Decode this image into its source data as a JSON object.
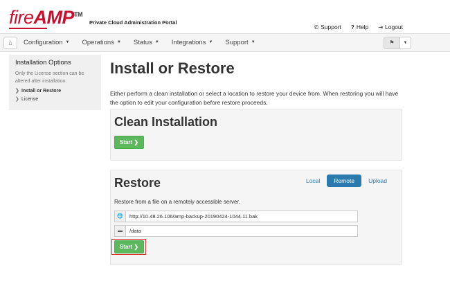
{
  "header": {
    "logo_prefix": "fire",
    "logo_main": "AMP",
    "logo_tm": "TM",
    "portal_title": "Private Cloud Administration Portal",
    "links": [
      {
        "icon": "phone-icon",
        "glyph": "✆",
        "label": "Support"
      },
      {
        "icon": "question-icon",
        "glyph": "?",
        "label": "Help"
      },
      {
        "icon": "logout-icon",
        "glyph": "⇥",
        "label": "Logout"
      }
    ]
  },
  "navbar": {
    "home_icon": "home-icon",
    "items": [
      "Configuration",
      "Operations",
      "Status",
      "Integrations",
      "Support"
    ],
    "flag_icon": "flag-icon"
  },
  "sidebar": {
    "title": "Installation Options",
    "note": "Only the License section can be altered after installation.",
    "items": [
      {
        "label": "Install or Restore",
        "active": true
      },
      {
        "label": "License",
        "active": false
      }
    ]
  },
  "main": {
    "title": "Install or Restore",
    "intro": "Either perform a clean installation or select a location to restore your device from. When restoring you will have the option to edit your configuration before restore proceeds."
  },
  "clean": {
    "title": "Clean Installation",
    "start_label": "Start ❯"
  },
  "restore": {
    "title": "Restore",
    "tabs": [
      "Local",
      "Remote",
      "Upload"
    ],
    "active_tab": "Remote",
    "description": "Restore from a file on a remotely accessible server.",
    "url_value": "http://10.48.26.106/amp-backup-20190424-1044.11.bak",
    "path_value": "/data",
    "start_label": "Start ❯"
  },
  "colors": {
    "brand_red": "#c8102e",
    "button_green": "#5cb85c",
    "tab_blue": "#2a7ab0",
    "highlight_red": "#d9302e"
  }
}
